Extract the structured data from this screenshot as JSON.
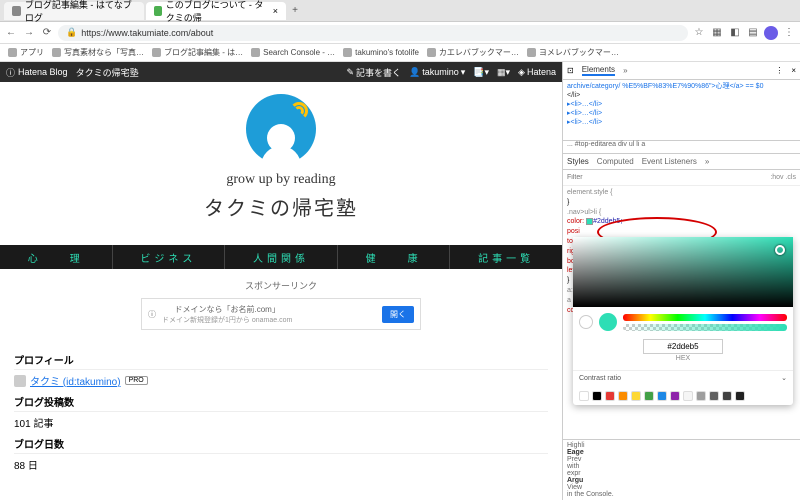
{
  "browser": {
    "tabs": [
      {
        "title": "ブログ記事編集 - はてなブログ",
        "active": false
      },
      {
        "title": "このブログについて - タクミの帰",
        "active": true
      }
    ],
    "url": "https://www.takumiate.com/about",
    "bookmarks": [
      "アプリ",
      "写真素材なら「写真…",
      "ブログ記事編集 - は…",
      "Search Console - …",
      "takumino's fotolife",
      "カエレバブックマー…",
      "ヨメレバブックマー…"
    ]
  },
  "hatena": {
    "brand": "Hatena Blog",
    "blog_name": "タクミの帰宅塾",
    "write": "記事を書く",
    "user": "takumino",
    "h_label": "Hatena"
  },
  "hero": {
    "tagline": "grow up by reading",
    "title": "タクミの帰宅塾"
  },
  "nav": [
    "心　　理",
    "ビジネス",
    "人間関係",
    "健　　康",
    "記事一覧"
  ],
  "sponsor": {
    "label": "スポンサーリンク",
    "ad_line1": "ドメインなら「お名前.com」",
    "ad_line2": "ドメイン新規登録が1円から onamae.com",
    "ad_btn": "開く"
  },
  "profile": {
    "h1": "プロフィール",
    "name": "タクミ (id:takumino)",
    "pro": "PRO",
    "h2": "ブログ投稿数",
    "posts": "101 記事",
    "h3": "ブログ日数",
    "days": "88 日"
  },
  "devtools": {
    "tab_elements": "Elements",
    "html_snippet": "archive/category/\n%E5%BF%83%E7%90%86\">心理</a> == $0",
    "li_close": "</li>",
    "li_tags": "▸<li>…</li>",
    "crumb": "... #top-editarea  div  ul  li  a",
    "sub_styles": "Styles",
    "sub_computed": "Computed",
    "sub_events": "Event Listeners",
    "filter_ph": "Filter",
    "hov": ":hov  .cls",
    "elstyle": "element.style {",
    "selector": ".nav>ul>li  {",
    "color_prop": "color:",
    "color_val": "#2ddeb5;",
    "pos_prop": "posi",
    "top_prop": "top:",
    "rig_prop": "rig",
    "bot_prop": "bot",
    "lef_prop": "lef",
    "avis": "a:visi",
    "a_sel": "a {",
    "col2": "col",
    "highlight": "Highli",
    "contrast": "Contrast ratio",
    "eager": "Eage",
    "prev": "Prev",
    "with": "with",
    "expr": "expr",
    "argu": "Argu",
    "view": "View",
    "console": "in the Console.",
    "hex_value": "#2ddeb5",
    "hex_label": "HEX"
  },
  "palette": [
    "#ffffff",
    "#000000",
    "#e53935",
    "#fb8c00",
    "#fdd835",
    "#43a047",
    "#1e88e5",
    "#8e24aa",
    "#f5f5f5",
    "#9e9e9e",
    "#616161",
    "#424242",
    "#212121"
  ]
}
